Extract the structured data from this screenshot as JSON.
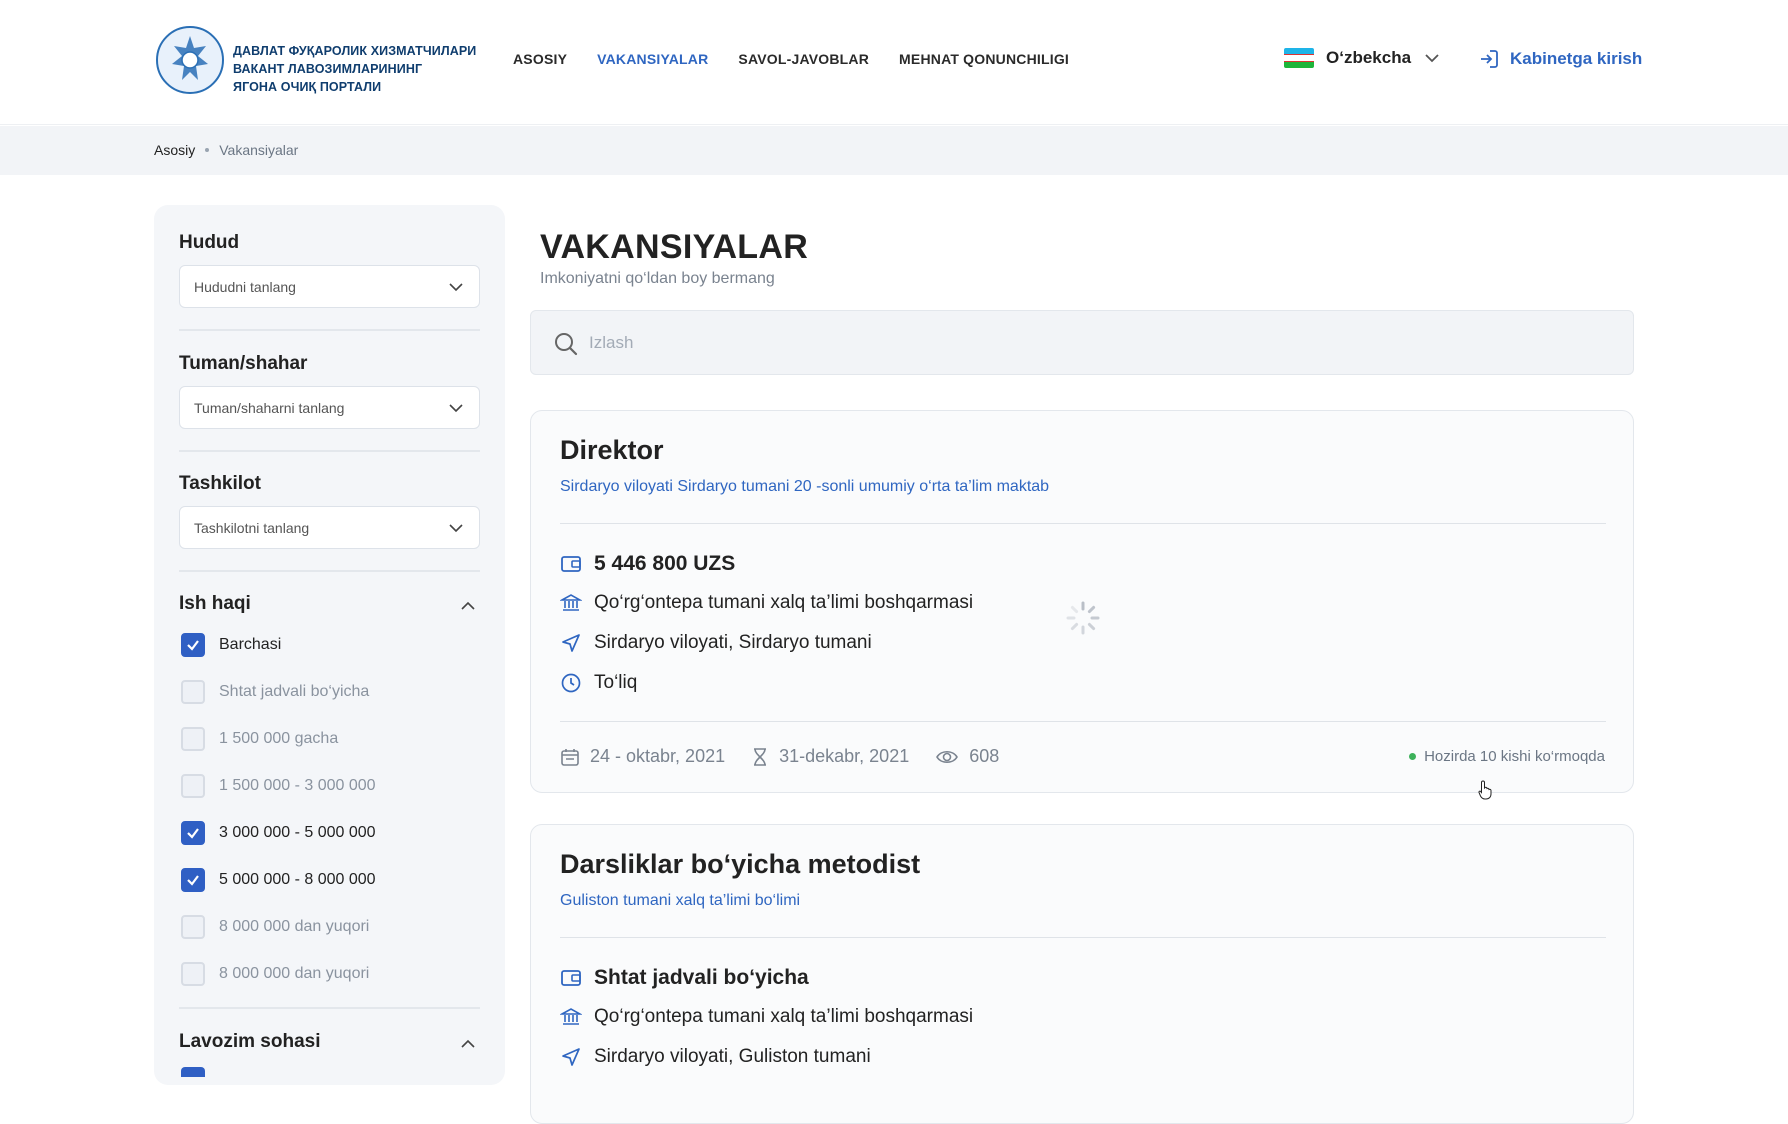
{
  "header": {
    "logo_lines": [
      "ДАВЛАТ ФУҚАРОЛИК ХИЗМАТЧИЛАРИ",
      "ВАКАНТ ЛАВОЗИМЛАРИНИНГ",
      "ЯГОНА ОЧИҚ ПОРТАЛИ"
    ],
    "nav": [
      {
        "label": "ASOSIY",
        "active": false
      },
      {
        "label": "VAKANSIYALAR",
        "active": true
      },
      {
        "label": "SAVOL-JAVOBLAR",
        "active": false
      },
      {
        "label": "MEHNAT QONUNCHILIGI",
        "active": false
      }
    ],
    "language": "O‘zbekcha",
    "login_label": "Kabinetga kirish"
  },
  "breadcrumb": {
    "home": "Asosiy",
    "current": "Vakansiyalar"
  },
  "sidebar": {
    "region": {
      "title": "Hudud",
      "placeholder": "Hududni tanlang"
    },
    "district": {
      "title": "Tuman/shahar",
      "placeholder": "Tuman/shaharni tanlang"
    },
    "organization": {
      "title": "Tashkilot",
      "placeholder": "Tashkilotni tanlang"
    },
    "salary": {
      "title": "Ish haqi",
      "options": [
        {
          "label": "Barchasi",
          "checked": true
        },
        {
          "label": "Shtat jadvali bo‘yicha",
          "checked": false
        },
        {
          "label": "1 500 000 gacha",
          "checked": false
        },
        {
          "label": "1 500 000 - 3 000 000",
          "checked": false
        },
        {
          "label": "3 000 000 - 5 000 000",
          "checked": true
        },
        {
          "label": "5 000 000 - 8 000 000",
          "checked": true
        },
        {
          "label": "8 000 000 dan yuqori",
          "checked": false
        },
        {
          "label": "8 000 000 dan yuqori",
          "checked": false
        }
      ]
    },
    "position_area": {
      "title": "Lavozim sohasi"
    }
  },
  "main": {
    "title": "VAKANSIYALAR",
    "subtitle": "Imkoniyatni qo‘ldan boy bermang",
    "search_placeholder": "Izlash",
    "vacancies": [
      {
        "title": "Direktor",
        "organization": "Sirdaryo viloyati Sirdaryo tumani 20 -sonli umumiy o‘rta ta’lim maktab",
        "salary": "5 446 800 UZS",
        "department": "Qo‘rg‘ontepa tumani xalq ta’limi boshqarmasi",
        "location": "Sirdaryo viloyati, Sirdaryo tumani",
        "employment": "To‘liq",
        "published": "24 - oktabr, 2021",
        "deadline": "31-dekabr, 2021",
        "views": "608",
        "viewing_now": "Hozirda 10 kishi ko‘rmoqda"
      },
      {
        "title": "Darsliklar bo‘yicha metodist",
        "organization": "Guliston tumani xalq ta’limi bo‘limi",
        "salary": "Shtat jadvali bo‘yicha",
        "department": "Qo‘rg‘ontepa tumani xalq ta’limi boshqarmasi",
        "location": "Sirdaryo viloyati, Guliston tumani"
      }
    ]
  },
  "colors": {
    "accent": "#2f66c1",
    "checkbox": "#2f5fc4",
    "online": "#3cb15a"
  }
}
